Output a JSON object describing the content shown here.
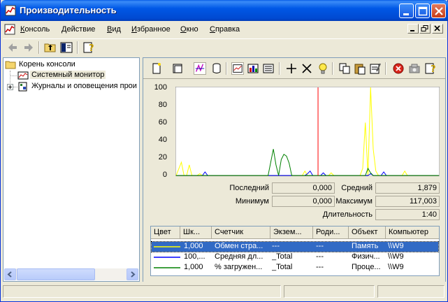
{
  "window": {
    "title": "Производительность"
  },
  "menu": {
    "items": [
      {
        "label": "Консоль",
        "ul": "К",
        "rest": "онсоль"
      },
      {
        "label": "Действие",
        "ul": "Д",
        "rest": "ействие"
      },
      {
        "label": "Вид",
        "ul": "В",
        "rest": "ид"
      },
      {
        "label": "Избранное",
        "ul": "И",
        "rest": "збранное"
      },
      {
        "label": "Окно",
        "ul": "О",
        "rest": "кно"
      },
      {
        "label": "Справка",
        "ul": "С",
        "rest": "правка"
      }
    ]
  },
  "tree": {
    "root": "Корень консоли",
    "monitor": "Системный монитор",
    "logs": "Журналы и оповещения прои"
  },
  "chart_data": {
    "type": "line",
    "ylim": [
      0,
      100
    ],
    "yticks": [
      "100",
      "80",
      "60",
      "40",
      "20",
      "0"
    ],
    "xlim": [
      0,
      100
    ],
    "current_time_marker": 54,
    "series": [
      {
        "color": "#ffff00",
        "values": [
          [
            0,
            0
          ],
          [
            2,
            15
          ],
          [
            3,
            0
          ],
          [
            4,
            0
          ],
          [
            5,
            12
          ],
          [
            6,
            0
          ],
          [
            8,
            0
          ],
          [
            9,
            2
          ],
          [
            10,
            0
          ],
          [
            48,
            0
          ],
          [
            49,
            5
          ],
          [
            50,
            0
          ],
          [
            54,
            0
          ],
          [
            55,
            0
          ],
          [
            56,
            0
          ],
          [
            57,
            0
          ],
          [
            58,
            0
          ],
          [
            59,
            3
          ],
          [
            60,
            0
          ],
          [
            70,
            0
          ],
          [
            71,
            8
          ],
          [
            72,
            60
          ],
          [
            73,
            0
          ],
          [
            74,
            100
          ],
          [
            75,
            30
          ],
          [
            76,
            5
          ],
          [
            77,
            0
          ],
          [
            86,
            0
          ],
          [
            87,
            5
          ],
          [
            88,
            0
          ],
          [
            100,
            0
          ]
        ]
      },
      {
        "color": "#0000ff",
        "values": [
          [
            0,
            0
          ],
          [
            10,
            0
          ],
          [
            11,
            4
          ],
          [
            12,
            0
          ],
          [
            30,
            0
          ],
          [
            49,
            0
          ],
          [
            50,
            2
          ],
          [
            51,
            5
          ],
          [
            52,
            0
          ],
          [
            55,
            0
          ],
          [
            56,
            3
          ],
          [
            57,
            0
          ],
          [
            73,
            0
          ],
          [
            74,
            2
          ],
          [
            75,
            0
          ],
          [
            78,
            0
          ],
          [
            79,
            4
          ],
          [
            80,
            0
          ],
          [
            100,
            0
          ]
        ]
      },
      {
        "color": "#008000",
        "values": [
          [
            0,
            0
          ],
          [
            35,
            0
          ],
          [
            36,
            15
          ],
          [
            37,
            30
          ],
          [
            38,
            12
          ],
          [
            39,
            0
          ],
          [
            40,
            18
          ],
          [
            41,
            24
          ],
          [
            42,
            22
          ],
          [
            43,
            14
          ],
          [
            44,
            0
          ],
          [
            72,
            0
          ],
          [
            73,
            8
          ],
          [
            74,
            3
          ],
          [
            75,
            0
          ],
          [
            100,
            0
          ]
        ]
      }
    ]
  },
  "stats": {
    "last_label": "Последний",
    "last_value": "0,000",
    "avg_label": "Средний",
    "avg_value": "1,879",
    "min_label": "Минимум",
    "min_value": "0,000",
    "max_label": "Максимум",
    "max_value": "117,003",
    "dur_label": "Длительность",
    "dur_value": "1:40"
  },
  "counters": {
    "headers": [
      "Цвет",
      "Шк...",
      "Счетчик",
      "Экзем...",
      "Роди...",
      "Объект",
      "Компьютер"
    ],
    "rows": [
      {
        "color": "#ffff00",
        "scale": "1,000",
        "counter": "Обмен стра...",
        "instance": "---",
        "parent": "---",
        "object": "Память",
        "computer": "\\\\W9"
      },
      {
        "color": "#0000ff",
        "scale": "100,...",
        "counter": "Средняя дл...",
        "instance": "_Total",
        "parent": "---",
        "object": "Физич...",
        "computer": "\\\\W9"
      },
      {
        "color": "#008000",
        "scale": "1,000",
        "counter": "% загружен...",
        "instance": "_Total",
        "parent": "---",
        "object": "Проце...",
        "computer": "\\\\W9"
      }
    ]
  }
}
